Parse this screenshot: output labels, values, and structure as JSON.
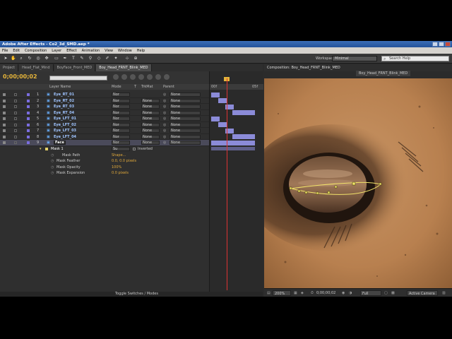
{
  "app": {
    "title": "Adobe After Effects - Co2_3d_SMD.aep *"
  },
  "menu": [
    "File",
    "Edit",
    "Composition",
    "Layer",
    "Effect",
    "Animation",
    "View",
    "Window",
    "Help"
  ],
  "toolbar": {
    "workspace_label": "Workspace:",
    "workspace_value": "Minimal",
    "search_placeholder": "Search Help"
  },
  "tabs": [
    {
      "label": "Project",
      "active": false
    },
    {
      "label": "Head_Flat_Mind",
      "active": false
    },
    {
      "label": "BoyFace_Front_MED",
      "active": false
    },
    {
      "label": "Boy_Head_FRNT_Blink_MED",
      "active": true
    }
  ],
  "composition_panel": {
    "title": "Composition: Boy_Head_FRNT_Blink_MED",
    "subtab": "Boy_Head_FRNT_Blink_MED"
  },
  "timeline": {
    "timecode": "0;00;00;02",
    "columns": {
      "layer_name": "Layer Name",
      "mode": "Mode",
      "t": "T",
      "trkmat": "TrkMat",
      "parent": "Parent"
    },
    "ruler": {
      "start": "00f",
      "end": "05f"
    },
    "layers": [
      {
        "num": "1",
        "name": "Eye_RT_01",
        "mode": "Nor",
        "trk": "",
        "parent": "None"
      },
      {
        "num": "2",
        "name": "Eye_RT_02",
        "mode": "Nor",
        "trk": "None",
        "parent": "None"
      },
      {
        "num": "3",
        "name": "Eye_RT_03",
        "mode": "Nor",
        "trk": "None",
        "parent": "None"
      },
      {
        "num": "4",
        "name": "Eye_RT_04",
        "mode": "Nor",
        "trk": "None",
        "parent": "None"
      },
      {
        "num": "5",
        "name": "Eye_LFT_01",
        "mode": "Nor",
        "trk": "None",
        "parent": "None"
      },
      {
        "num": "6",
        "name": "Eye_LFT_02",
        "mode": "Nor",
        "trk": "None",
        "parent": "None"
      },
      {
        "num": "7",
        "name": "Eye_LFT_03",
        "mode": "Nor",
        "trk": "None",
        "parent": "None"
      },
      {
        "num": "8",
        "name": "Eye_LFT_04",
        "mode": "Nor",
        "trk": "None",
        "parent": "None"
      },
      {
        "num": "9",
        "name": "Face",
        "mode": "Nor",
        "trk": "None",
        "parent": "None"
      }
    ],
    "mask": {
      "name": "Mask 1",
      "mode": "Su",
      "inverted": "Inverted",
      "props": [
        {
          "name": "Mask Path",
          "value": "Shape..."
        },
        {
          "name": "Mask Feather",
          "value": "0.0, 0.0 pixels"
        },
        {
          "name": "Mask Opacity",
          "value": "100%"
        },
        {
          "name": "Mask Expansion",
          "value": "0.0 pixels"
        }
      ]
    },
    "status": "Toggle Switches / Modes"
  },
  "viewer_status": {
    "zoom": "200%",
    "timecode": "0;00;00;02",
    "resolution": "Full",
    "camera": "Active Camera"
  }
}
